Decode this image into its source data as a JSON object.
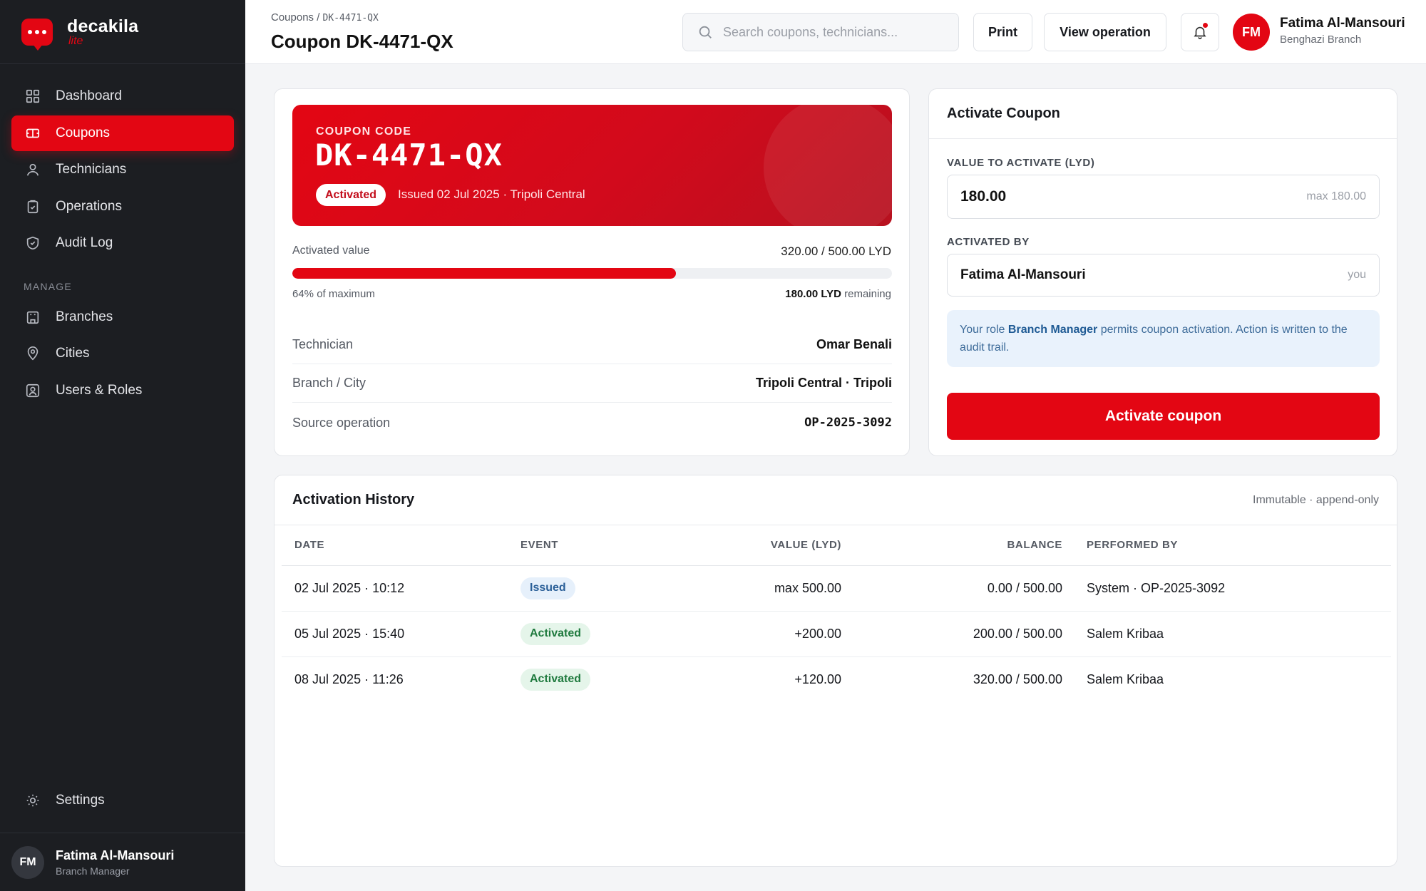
{
  "brand": {
    "name": "decakila",
    "sub": "lite"
  },
  "sidebar": {
    "items": [
      {
        "label": "Dashboard",
        "icon": "grid-icon",
        "active": false
      },
      {
        "label": "Coupons",
        "icon": "ticket-icon",
        "active": true
      },
      {
        "label": "Technicians",
        "icon": "user-icon",
        "active": false
      },
      {
        "label": "Operations",
        "icon": "clipboard-icon",
        "active": false
      },
      {
        "label": "Audit Log",
        "icon": "shield-icon",
        "active": false
      }
    ],
    "section_label": "MANAGE",
    "manage_items": [
      {
        "label": "Branches",
        "icon": "building-icon"
      },
      {
        "label": "Cities",
        "icon": "map-pin-icon"
      },
      {
        "label": "Users & Roles",
        "icon": "user-badge-icon"
      }
    ],
    "settings_label": "Settings",
    "user": {
      "initials": "FM",
      "name": "Fatima Al-Mansouri",
      "role": "Branch Manager"
    }
  },
  "header": {
    "breadcrumb_prefix": "Coupons / ",
    "breadcrumb_code": "DK-4471-QX",
    "title": "Coupon DK-4471-QX",
    "search_placeholder": "Search coupons, technicians...",
    "print_label": "Print",
    "view_operation_label": "View operation",
    "user": {
      "initials": "FM",
      "name": "Fatima Al-Mansouri",
      "branch": "Benghazi Branch"
    }
  },
  "coupon": {
    "code_label": "COUPON CODE",
    "code": "DK-4471-QX",
    "status": "Activated",
    "issued_text": "Issued 02 Jul 2025 · Tripoli Central",
    "activated_value_label": "Activated value",
    "activated_value_text": "320.00 / 500.00 LYD",
    "progress_fraction": 0.64,
    "percent_text": "64% of maximum",
    "remaining_amount": "180.00 LYD",
    "remaining_suffix": " remaining",
    "details": [
      {
        "key": "Technician",
        "value": "Omar Benali"
      },
      {
        "key": "Branch / City",
        "value": "Tripoli Central · Tripoli"
      },
      {
        "key": "Source operation",
        "value": "OP-2025-3092"
      }
    ]
  },
  "activate": {
    "title": "Activate Coupon",
    "value_label": "VALUE TO ACTIVATE (LYD)",
    "value": "180.00",
    "value_hint": "max 180.00",
    "by_label": "ACTIVATED BY",
    "by_value": "Fatima Al-Mansouri",
    "by_hint": "you",
    "note_prefix": "Your role ",
    "note_role": "Branch Manager",
    "note_suffix": " permits coupon activation. Action is written to the audit trail.",
    "button_label": "Activate coupon"
  },
  "history": {
    "title": "Activation History",
    "meta": "Immutable · append-only",
    "columns": [
      "DATE",
      "EVENT",
      "VALUE (LYD)",
      "BALANCE",
      "PERFORMED BY"
    ],
    "rows": [
      {
        "date": "02 Jul 2025 · 10:12",
        "event": "Issued",
        "event_type": "issued",
        "value": "max 500.00",
        "balance": "0.00 / 500.00",
        "by": "System · OP-2025-3092"
      },
      {
        "date": "05 Jul 2025 · 15:40",
        "event": "Activated",
        "event_type": "activated",
        "value": "+200.00",
        "balance": "200.00 / 500.00",
        "by": "Salem Kribaa"
      },
      {
        "date": "08 Jul 2025 · 11:26",
        "event": "Activated",
        "event_type": "activated",
        "value": "+120.00",
        "balance": "320.00 / 500.00",
        "by": "Salem Kribaa"
      }
    ]
  },
  "colors": {
    "accent": "#e30613",
    "sidebar_bg": "#1c1e22",
    "success": "#1f7a3e",
    "info": "#2a5f98"
  }
}
